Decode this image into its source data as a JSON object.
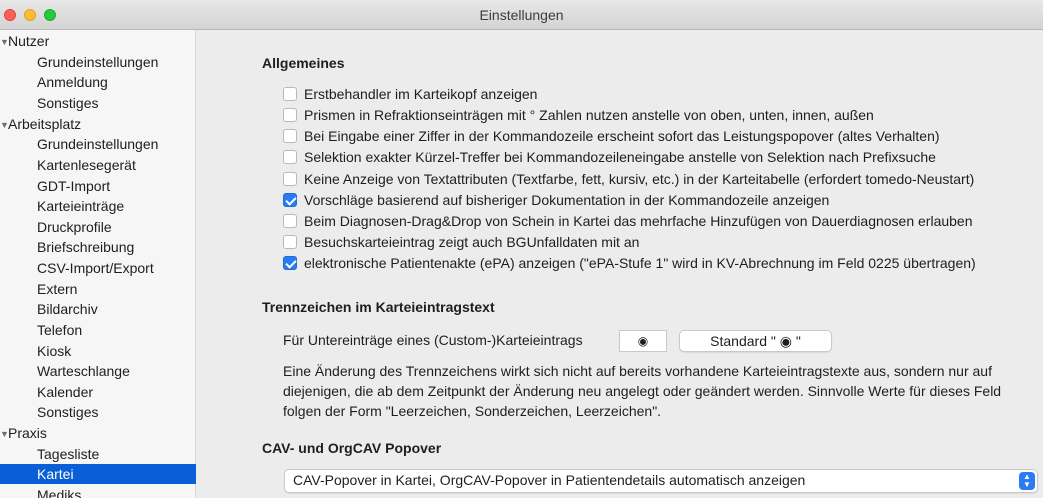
{
  "window": {
    "title": "Einstellungen"
  },
  "sidebar": {
    "groups": [
      {
        "label": "Nutzer",
        "items": [
          "Grundeinstellungen",
          "Anmeldung",
          "Sonstiges"
        ]
      },
      {
        "label": "Arbeitsplatz",
        "items": [
          "Grundeinstellungen",
          "Kartenlesegerät",
          "GDT-Import",
          "Karteieinträge",
          "Druckprofile",
          "Briefschreibung",
          "CSV-Import/Export",
          "Extern",
          "Bildarchiv",
          "Telefon",
          "Kiosk",
          "Warteschlange",
          "Kalender",
          "Sonstiges"
        ]
      },
      {
        "label": "Praxis",
        "items": [
          "Tagesliste",
          "Kartei",
          "Mediks"
        ]
      }
    ],
    "selected_item": "Kartei",
    "disclosure_icon": "triangle-down-icon"
  },
  "general": {
    "title": "Allgemeines",
    "options": [
      {
        "label": "Erstbehandler im Karteikopf anzeigen",
        "checked": false
      },
      {
        "label": "Prismen in Refraktionseinträgen mit ° Zahlen nutzen anstelle von oben, unten, innen, außen",
        "checked": false
      },
      {
        "label": "Bei Eingabe einer Ziffer in der Kommandozeile erscheint sofort das Leistungspopover (altes Verhalten)",
        "checked": false
      },
      {
        "label": "Selektion exakter Kürzel-Treffer bei Kommandozeileneingabe anstelle von Selektion nach Prefixsuche",
        "checked": false
      },
      {
        "label": "Keine Anzeige von Textattributen (Textfarbe, fett, kursiv, etc.) in der Karteitabelle (erfordert tomedo-Neustart)",
        "checked": false
      },
      {
        "label": "Vorschläge basierend auf bisheriger Dokumentation in der Kommandozeile anzeigen",
        "checked": true
      },
      {
        "label": "Beim Diagnosen-Drag&Drop von Schein in Kartei das mehrfache Hinzufügen von Dauerdiagnosen erlauben",
        "checked": false
      },
      {
        "label": "Besuchskarteieintrag zeigt auch BGUnfalldaten mit an",
        "checked": false
      },
      {
        "label": "elektronische Patientenakte (ePA) anzeigen (\"ePA-Stufe 1\" wird in KV-Abrechnung im Feld 0225 übertragen)",
        "checked": true
      }
    ]
  },
  "separator": {
    "title": "Trennzeichen im Karteieintragstext",
    "field_label": "Für Untereinträge eines (Custom-)Karteieintrags",
    "field_value": "◉",
    "standard_button": "Standard \" ◉ \"",
    "description": "Eine Änderung des Trennzeichens wirkt sich nicht auf bereits vorhandene Karteieintragstexte aus, sondern nur auf diejenigen, die ab dem Zeitpunkt der Änderung neu angelegt oder geändert werden. Sinnvolle Werte für dieses Feld folgen der Form \"Leerzeichen, Sonderzeichen, Leerzeichen\"."
  },
  "cav": {
    "title": "CAV- und OrgCAV Popover",
    "popup_value": "CAV-Popover in Kartei, OrgCAV-Popover in Patientendetails automatisch anzeigen"
  },
  "colors": {
    "accent": "#2b7bf5",
    "selection": "#0a5fd7",
    "close": "#fe5f57",
    "minimize": "#febc2e",
    "zoom": "#28c840"
  }
}
